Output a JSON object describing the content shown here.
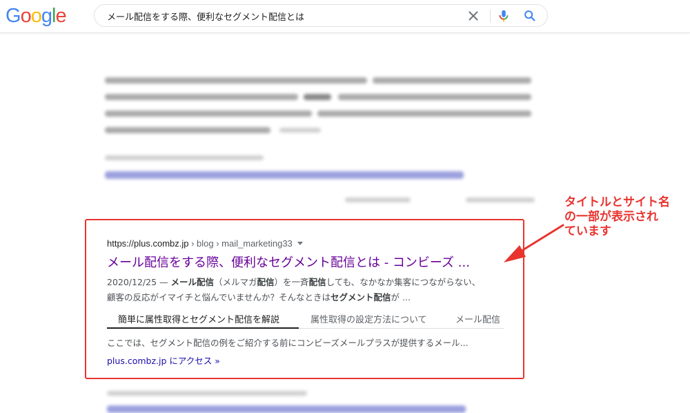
{
  "header": {
    "logo": [
      "G",
      "o",
      "o",
      "g",
      "l",
      "e"
    ],
    "logo_colors": [
      "#4285f4",
      "#ea4335",
      "#fbbc05",
      "#4285f4",
      "#34a853",
      "#ea4335"
    ],
    "search_value": "メール配信をする際、便利なセグメント配信とは"
  },
  "result": {
    "url": "https://plus.combz.jp",
    "path": " › blog › mail_marketing33",
    "title": "メール配信をする際、便利なセグメント配信とは - コンビーズ ...",
    "snippet_date": "2020/12/25 — ",
    "snippet_line1_parts": [
      "メール配信",
      "（メルマガ",
      "配信",
      "）を一斉",
      "配信",
      "しても、なかなか集客につながらない、"
    ],
    "snippet_line2_a": "顧客の反応がイマイチと悩んでいませんか？そんなときは",
    "snippet_line2_bold": "セグメント配信",
    "snippet_line2_b": "が ...",
    "tabs": [
      {
        "label": "簡単に属性取得とセグメント配信を解説",
        "active": true
      },
      {
        "label": "属性取得の設定方法について",
        "active": false
      },
      {
        "label": "メール配信",
        "active": false
      }
    ],
    "sub_snippet": "ここでは、セグメント配信の例をご紹介する前にコンビーズメールプラスが提供するメール...",
    "visit_link": "plus.combz.jp にアクセス »"
  },
  "annotation": {
    "text": "タイトルとサイト名\nの一部が表示され\nています",
    "color": "#e8342f"
  }
}
